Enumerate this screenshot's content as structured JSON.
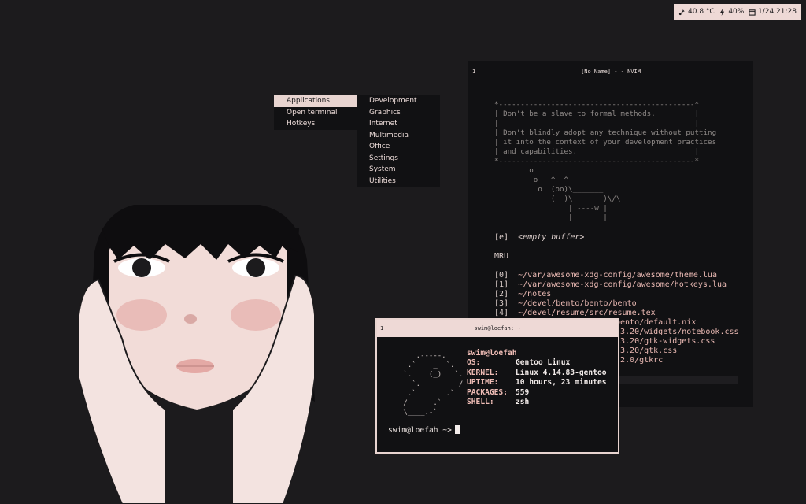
{
  "statusbar": {
    "temperature": "40.8 °C",
    "battery": "40%",
    "datetime": "1/24 21:28",
    "icons": [
      "thermometer-icon",
      "lightning-icon",
      "calendar-icon"
    ]
  },
  "menu": {
    "items": [
      "Applications",
      "Open terminal",
      "Hotkeys"
    ],
    "submenu": [
      "Development",
      "Graphics",
      "Internet",
      "Multimedia",
      "Office",
      "Settings",
      "System",
      "Utilities"
    ]
  },
  "nvim": {
    "tag": "1",
    "title": "[No Name] - - NVIM",
    "cowsay": "*---------------------------------------------*\n| Don't be a slave to formal methods.         |\n|                                             |\n| Don't blindly adopt any technique without putting |\n| it into the context of your development practices |\n| and capabilities.                           |\n*---------------------------------------------*\n        o\n         o   ^__^\n          o  (oo)\\_______\n             (__)\\       )\\/\\\n                 ||----w |\n                 ||     ||",
    "empty_index": "[e]",
    "empty_label": "<empty buffer>",
    "mru_heading": "MRU",
    "mru": [
      {
        "idx": "[0]",
        "path": "~/var/awesome-xdg-config/awesome/theme.lua"
      },
      {
        "idx": "[1]",
        "path": "~/var/awesome-xdg-config/awesome/hotkeys.lua"
      },
      {
        "idx": "[2]",
        "path": "~/notes"
      },
      {
        "idx": "[3]",
        "path": "~/devel/bento/bento/bento"
      },
      {
        "idx": "[4]",
        "path": "~/devel/resume/src/resume.tex"
      },
      {
        "idx": "",
        "path": "bento/default.nix"
      },
      {
        "idx": "",
        "path": "-3.20/widgets/notebook.css"
      },
      {
        "idx": "",
        "path": "-3.20/gtk-widgets.css"
      },
      {
        "idx": "",
        "path": "-3.20/gtk.css"
      },
      {
        "idx": "",
        "path": "-2.0/gtkrc"
      }
    ]
  },
  "terminal": {
    "tag": "1",
    "title": "swim@loefah: ~",
    "logo": "    .-----.\n  .`    _  `.\n `.    (_)   `.\n   `.         /\n  .`       .`\n /      .`\n \\____.-`",
    "user": "swim@loefah",
    "info": [
      {
        "key": "OS:",
        "value": "Gentoo Linux"
      },
      {
        "key": "KERNEL:",
        "value": "Linux 4.14.83-gentoo"
      },
      {
        "key": "UPTIME:",
        "value": "10 hours, 23 minutes"
      },
      {
        "key": "PACKAGES:",
        "value": "559"
      },
      {
        "key": "SHELL:",
        "value": "zsh"
      }
    ],
    "prompt": "swim@loefah ~>"
  },
  "colors": {
    "background": "#1c1b1d",
    "accent": "#eed9d6",
    "path": "#eab9b3",
    "panel": "#111113"
  }
}
